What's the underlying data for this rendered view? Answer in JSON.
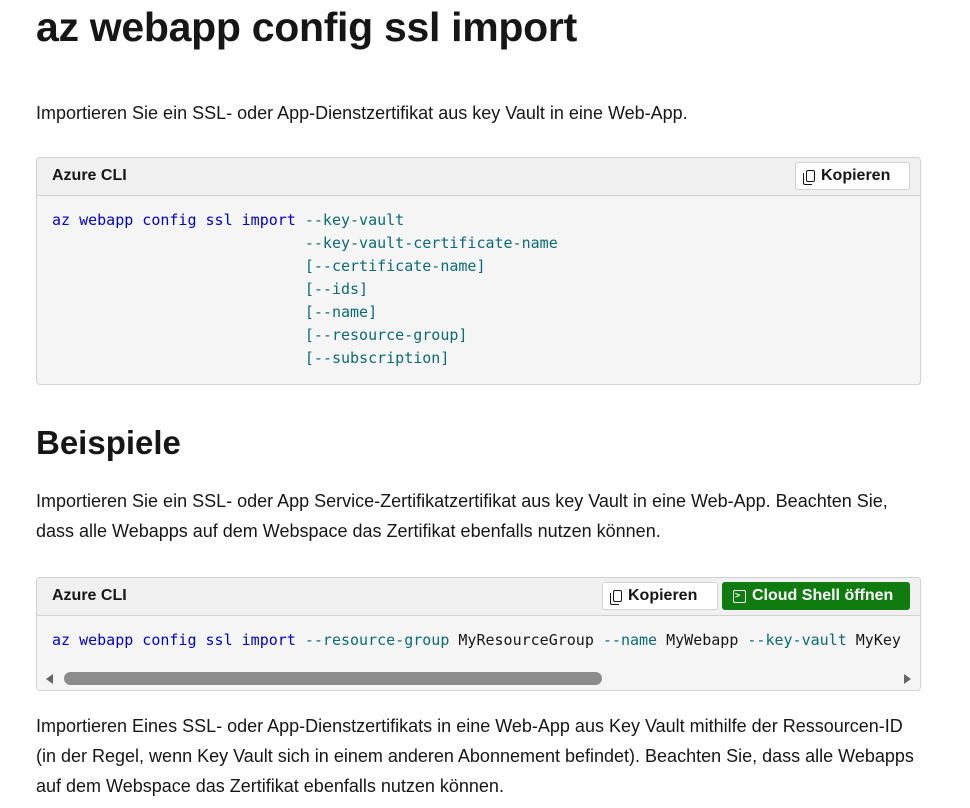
{
  "page": {
    "title": "az webapp config ssl import",
    "description": "Importieren Sie ein SSL- oder App-Dienstzertifikat aus key Vault in eine Web-App."
  },
  "syntax_block": {
    "language": "Azure CLI",
    "copy_label": "Kopieren",
    "command": "az webapp config ssl import",
    "params": [
      "--key-vault",
      "--key-vault-certificate-name",
      "[--certificate-name]",
      "[--ids]",
      "[--name]",
      "[--resource-group]",
      "[--subscription]"
    ]
  },
  "examples": {
    "heading": "Beispiele",
    "example1": {
      "description": "Importieren Sie ein SSL- oder App Service-Zertifikatzertifikat aus key Vault in eine Web-App. Beachten Sie, dass alle Webapps auf dem Webspace das Zertifikat ebenfalls nutzen können.",
      "language": "Azure CLI",
      "copy_label": "Kopieren",
      "cloud_shell_label": "Cloud Shell öffnen",
      "command": "az webapp config ssl import",
      "tokens": [
        {
          "type": "param",
          "text": "--resource-group"
        },
        {
          "type": "value",
          "text": "MyResourceGroup"
        },
        {
          "type": "param",
          "text": "--name"
        },
        {
          "type": "value",
          "text": "MyWebapp"
        },
        {
          "type": "param",
          "text": "--key-vault"
        },
        {
          "type": "value",
          "text": "MyKey"
        }
      ],
      "scroll_position": 0
    },
    "example2": {
      "description": "Importieren Eines SSL- oder App-Dienstzertifikats in eine Web-App aus Key Vault mithilfe der Ressourcen-ID (in der Regel, wenn Key Vault sich in einem anderen Abonnement befindet). Beachten Sie, dass alle Webapps auf dem Webspace das Zertifikat ebenfalls nutzen können."
    }
  },
  "colors": {
    "keyword": "#0000cd",
    "param": "#0a6b75",
    "cloud_shell_bg": "#107c10"
  },
  "icons": {
    "copy": "copy-icon",
    "cloud_shell": "terminal-icon"
  }
}
